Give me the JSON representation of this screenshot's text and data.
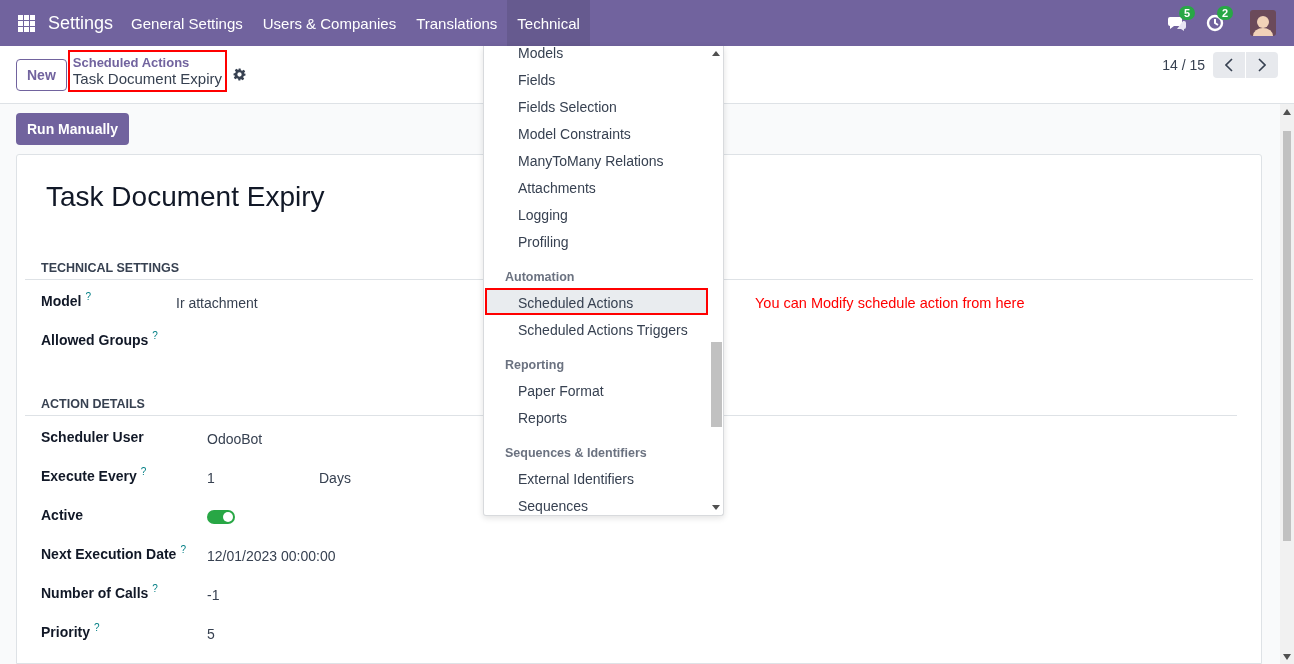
{
  "navbar": {
    "app_title": "Settings",
    "menus": [
      {
        "label": "General Settings",
        "selected": false
      },
      {
        "label": "Users & Companies",
        "selected": false
      },
      {
        "label": "Translations",
        "selected": false
      },
      {
        "label": "Technical",
        "selected": true
      }
    ],
    "messages_badge": "5",
    "activities_badge": "2"
  },
  "control_panel": {
    "new_button": "New",
    "breadcrumb": {
      "parent": "Scheduled Actions",
      "current": "Task Document Expiry",
      "annotated": true
    },
    "pager": "14 / 15"
  },
  "run_button": "Run Manually",
  "form": {
    "title": "Task Document Expiry",
    "sections": [
      {
        "heading": "TECHNICAL SETTINGS",
        "rows": [
          {
            "kind": "text",
            "label": "Model",
            "help": "?",
            "value": "Ir attachment"
          },
          {
            "kind": "text",
            "label": "Allowed Groups",
            "help": "?"
          }
        ]
      },
      {
        "heading": "ACTION DETAILS",
        "rows": [
          {
            "kind": "text",
            "label": "Scheduler User",
            "value": "OdooBot"
          },
          {
            "kind": "interval",
            "label": "Execute Every",
            "help": "?",
            "value": "1",
            "unit": "Days"
          },
          {
            "kind": "toggle",
            "label": "Active",
            "on": true
          },
          {
            "kind": "text",
            "label": "Next Execution Date",
            "help": "?",
            "value": "12/01/2023 00:00:00"
          },
          {
            "kind": "text",
            "label": "Number of Calls",
            "help": "?",
            "value": "-1"
          },
          {
            "kind": "text",
            "label": "Priority",
            "help": "?",
            "value": "5"
          }
        ]
      }
    ]
  },
  "technical_menu": [
    {
      "kind": "item",
      "label": "Models",
      "selected": false
    },
    {
      "kind": "item",
      "label": "Fields",
      "selected": false
    },
    {
      "kind": "item",
      "label": "Fields Selection",
      "selected": false
    },
    {
      "kind": "item",
      "label": "Model Constraints",
      "selected": false
    },
    {
      "kind": "item",
      "label": "ManyToMany Relations",
      "selected": false
    },
    {
      "kind": "item",
      "label": "Attachments",
      "selected": false
    },
    {
      "kind": "item",
      "label": "Logging",
      "selected": false
    },
    {
      "kind": "item",
      "label": "Profiling",
      "selected": false
    },
    {
      "kind": "header",
      "label": "Automation"
    },
    {
      "kind": "item",
      "label": "Scheduled Actions",
      "selected": true,
      "annotated": true
    },
    {
      "kind": "item",
      "label": "Scheduled Actions Triggers",
      "selected": false
    },
    {
      "kind": "header",
      "label": "Reporting"
    },
    {
      "kind": "item",
      "label": "Paper Format",
      "selected": false
    },
    {
      "kind": "item",
      "label": "Reports",
      "selected": false
    },
    {
      "kind": "header",
      "label": "Sequences & Identifiers"
    },
    {
      "kind": "item",
      "label": "External Identifiers",
      "selected": false
    },
    {
      "kind": "item",
      "label": "Sequences",
      "selected": false
    }
  ],
  "annotation": "You can Modify schedule action from here"
}
